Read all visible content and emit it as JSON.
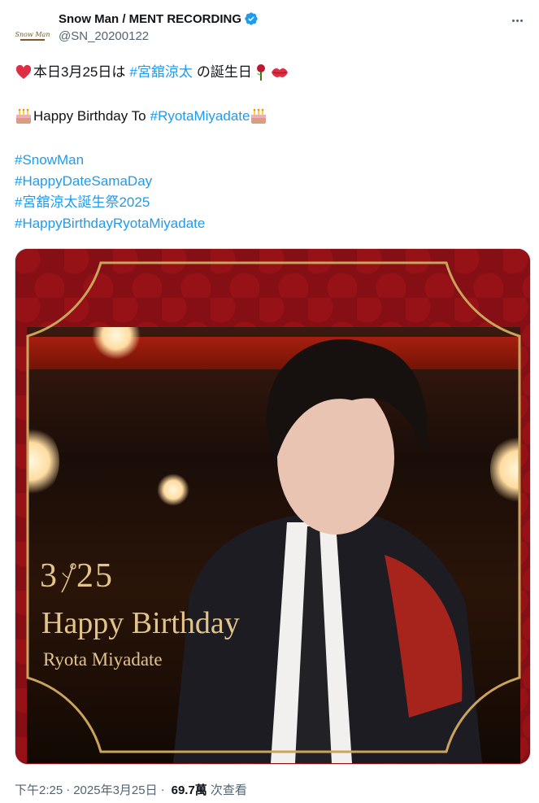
{
  "account": {
    "display_name": "Snow Man / MENT RECORDING",
    "handle": "@SN_20200122",
    "avatar_logo_text": "Snow Man",
    "verified_color": "#1d9bf0"
  },
  "tweet": {
    "line1_prefix": "本日3月25日は",
    "line1_tag": "#宮舘涼太",
    "line1_suffix": "の誕生日",
    "line2_prefix": "Happy Birthday To",
    "line2_tag": "#RyotaMiyadate",
    "hashtags": [
      "#SnowMan",
      "#HappyDateSamaDay",
      "#宮舘涼太誕生祭2025",
      "#HappyBirthdayRyotaMiyadate"
    ],
    "emoji_names": [
      "heart-emoji",
      "rose-emoji",
      "kiss-emoji",
      "cake-emoji"
    ]
  },
  "media": {
    "date_text": "3",
    "date_text_after": "25",
    "greeting": "Happy Birthday",
    "person_name": "Ryota Miyadate",
    "frame_color": "#c9a45a",
    "background_color": "#860f15"
  },
  "footer": {
    "time": "下午2:25",
    "date": "2025年3月25日",
    "views": "69.7萬",
    "views_label": "次查看"
  }
}
